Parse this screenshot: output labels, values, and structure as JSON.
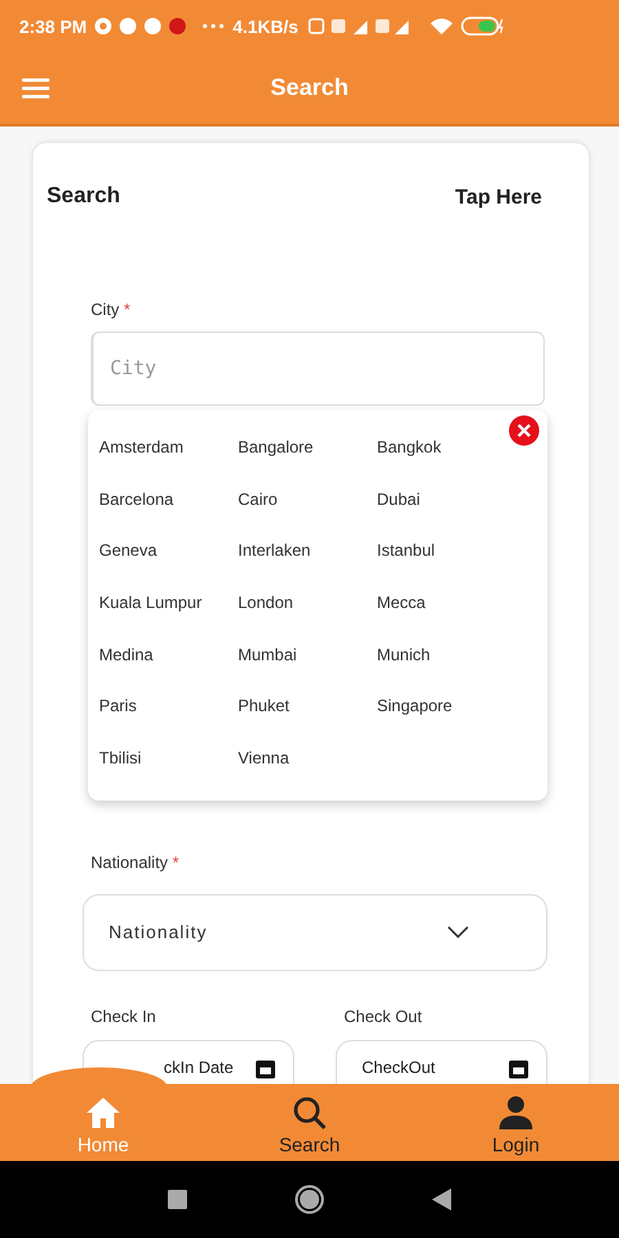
{
  "status_bar": {
    "time": "2:38 PM",
    "speed": "4.1KB/s"
  },
  "app_bar": {
    "title": "Search"
  },
  "card": {
    "title": "Search",
    "action": "Tap Here"
  },
  "city": {
    "label": "City",
    "required": "*",
    "placeholder": "City"
  },
  "city_options": [
    {
      "label": "Amsterdam"
    },
    {
      "label": "Bangalore"
    },
    {
      "label": "Bangkok"
    },
    {
      "label": "Barcelona"
    },
    {
      "label": "Cairo"
    },
    {
      "label": "Dubai"
    },
    {
      "label": "Geneva"
    },
    {
      "label": "Interlaken"
    },
    {
      "label": "Istanbul"
    },
    {
      "label": "Kuala Lumpur"
    },
    {
      "label": "London"
    },
    {
      "label": "Mecca"
    },
    {
      "label": "Medina"
    },
    {
      "label": "Mumbai"
    },
    {
      "label": "Munich"
    },
    {
      "label": "Paris"
    },
    {
      "label": "Phuket"
    },
    {
      "label": "Singapore"
    },
    {
      "label": "Tbilisi"
    },
    {
      "label": "Vienna"
    }
  ],
  "nationality": {
    "label": "Nationality",
    "required": "*",
    "placeholder": "Nationality"
  },
  "check_in": {
    "label": "Check In",
    "placeholder": "ckIn Date"
  },
  "check_out": {
    "label": "Check Out",
    "placeholder": "CheckOut"
  },
  "bottom_nav": [
    {
      "label": "Home",
      "kind": "home",
      "selected": true
    },
    {
      "label": "Search",
      "kind": "search",
      "selected": false
    },
    {
      "label": "Login",
      "kind": "person",
      "selected": false
    }
  ]
}
